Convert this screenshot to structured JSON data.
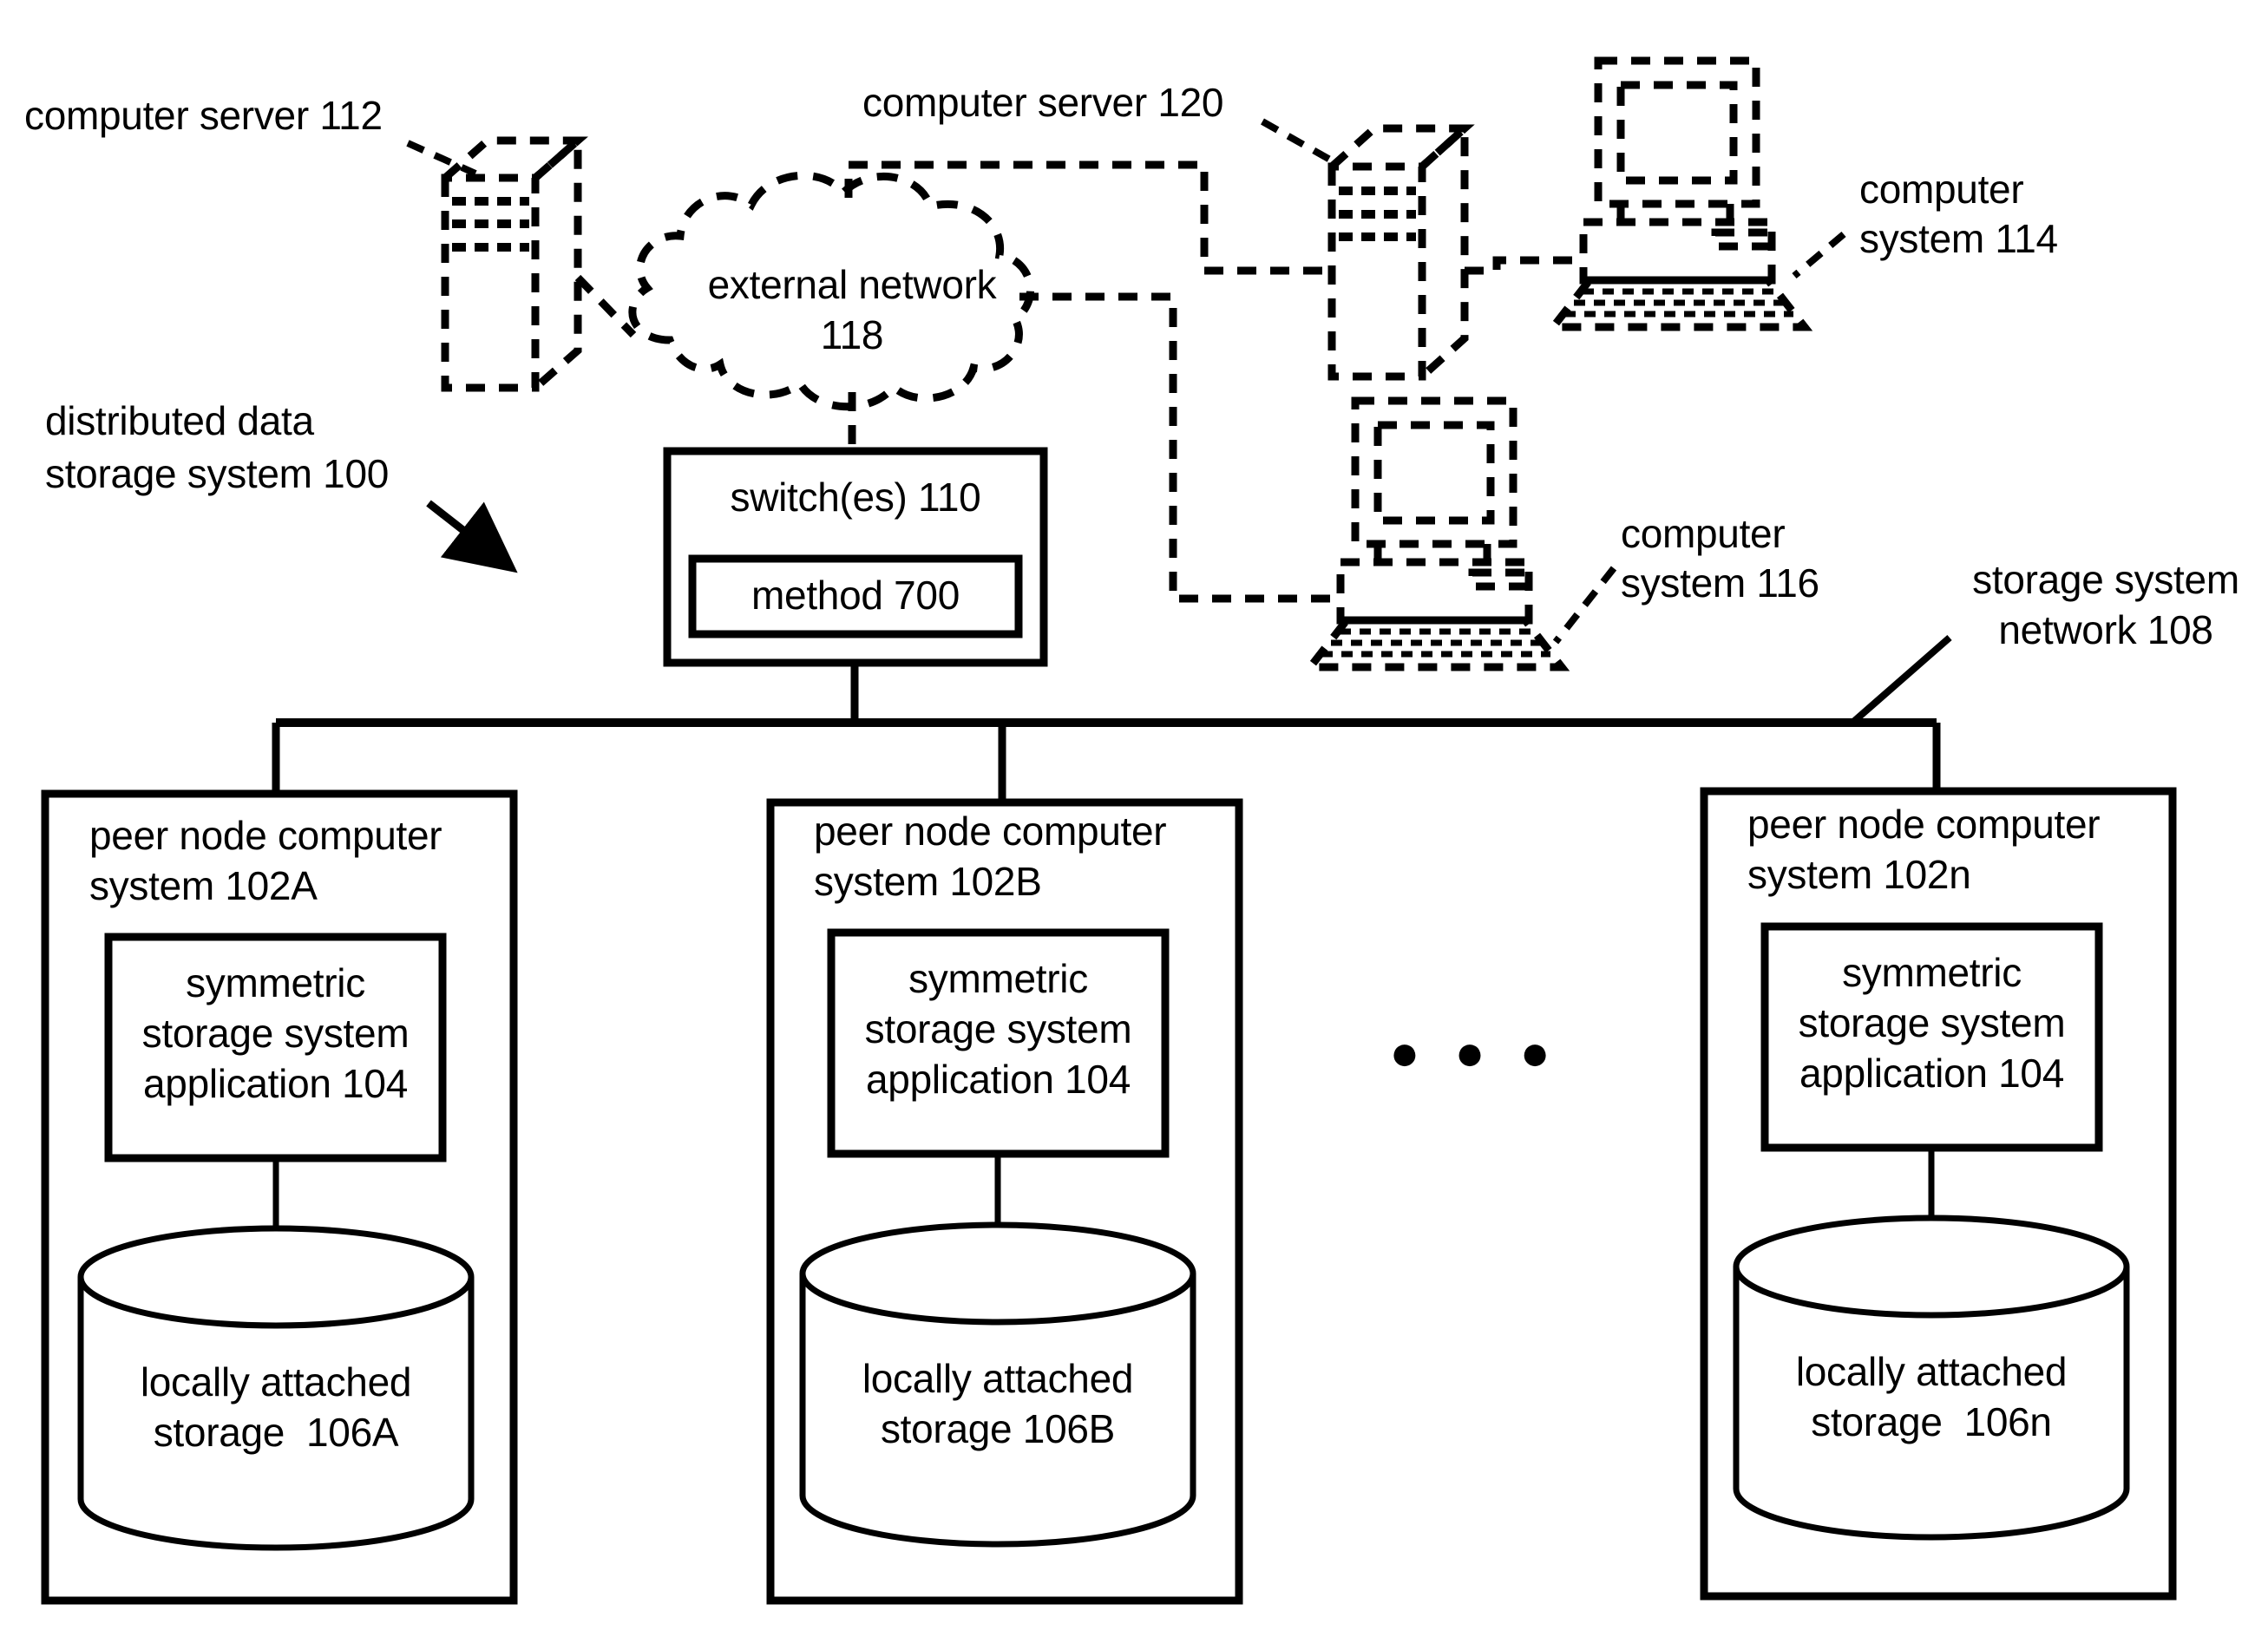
{
  "figure": {
    "title": "distributed data storage system 100",
    "stroke_color": "#000000",
    "background_color": "#ffffff"
  },
  "labels": {
    "computer_server_112": "computer server 112",
    "computer_server_120": "computer server 120",
    "computer_system_114_line1": "computer",
    "computer_system_114_line2": "system 114",
    "computer_system_116_line1": "computer",
    "computer_system_116_line2": "system 116",
    "distributed_system_line1": "distributed data",
    "distributed_system_line2": "storage system 100",
    "external_network_line1": "external network",
    "external_network_line2": "118",
    "storage_system_network_line1": "storage system",
    "storage_system_network_line2": "network 108",
    "ellipsis": "● ● ●"
  },
  "switch_box": {
    "title": "switch(es) 110",
    "inner_box_label": "method 700"
  },
  "nodes": [
    {
      "id": "102A",
      "title_line1": "peer node computer",
      "title_line2": "system 102A",
      "app_line1": "symmetric",
      "app_line2": "storage system",
      "app_line3": "application 104",
      "storage_line1": "locally attached",
      "storage_line2": "storage  106A"
    },
    {
      "id": "102B",
      "title_line1": "peer node computer",
      "title_line2": "system 102B",
      "app_line1": "symmetric",
      "app_line2": "storage system",
      "app_line3": "application 104",
      "storage_line1": "locally attached",
      "storage_line2": "storage 106B"
    },
    {
      "id": "102n",
      "title_line1": "peer node computer",
      "title_line2": "system 102n",
      "app_line1": "symmetric",
      "app_line2": "storage system",
      "app_line3": "application 104",
      "storage_line1": "locally attached",
      "storage_line2": "storage  106n"
    }
  ]
}
